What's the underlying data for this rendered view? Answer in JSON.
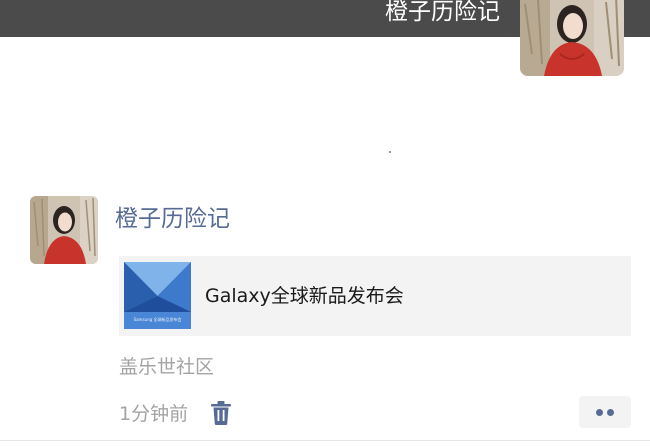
{
  "header": {
    "user_name": "橙子历险记"
  },
  "post": {
    "author": "橙子历险记",
    "link": {
      "title": "Galaxy全球新品发布会",
      "thumb_text": "Samsung 全球新品发布会"
    },
    "source": "盖乐世社区",
    "time": "1分钟前"
  },
  "icons": {
    "delete": "trash-icon",
    "more": "more-dots-icon"
  },
  "colors": {
    "author_link": "#576b95",
    "header_bg": "#4b4b4b",
    "meta_text": "#a3a3a3",
    "card_bg": "#f3f3f3"
  }
}
